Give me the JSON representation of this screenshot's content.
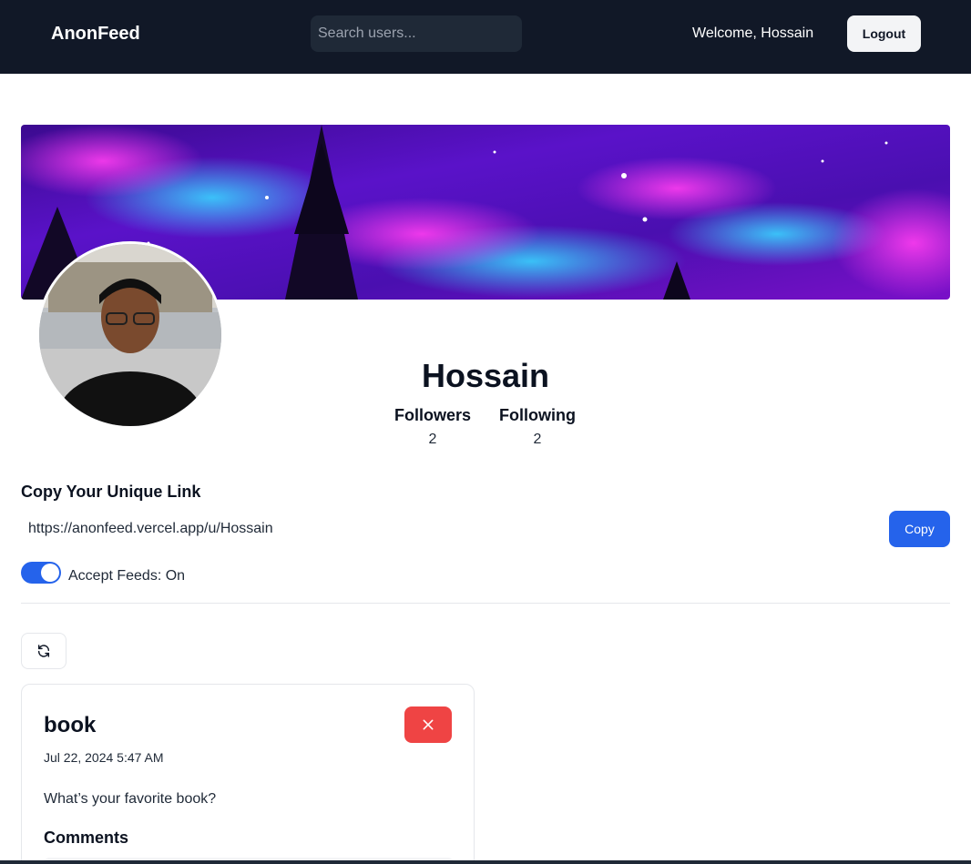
{
  "navbar": {
    "brand": "AnonFeed",
    "search_placeholder": "Search users...",
    "welcome_text": "Welcome, Hossain",
    "logout_label": "Logout"
  },
  "profile": {
    "name": "Hossain",
    "followers_label": "Followers",
    "followers_count": "2",
    "following_label": "Following",
    "following_count": "2"
  },
  "unique_link": {
    "title": "Copy Your Unique Link",
    "url": "https://anonfeed.vercel.app/u/Hossain",
    "copy_label": "Copy"
  },
  "accept_feeds": {
    "label": "Accept Feeds: On",
    "enabled": true
  },
  "icons": {
    "refresh": "refresh-icon",
    "delete": "close-icon"
  },
  "feed": {
    "messages": [
      {
        "title": "book",
        "date": "Jul 22, 2024 5:47 AM",
        "content": "What’s your favorite book?",
        "comments_title": "Comments"
      }
    ]
  },
  "colors": {
    "navbar_bg": "#111827",
    "primary": "#2563eb",
    "danger": "#ef4444"
  }
}
